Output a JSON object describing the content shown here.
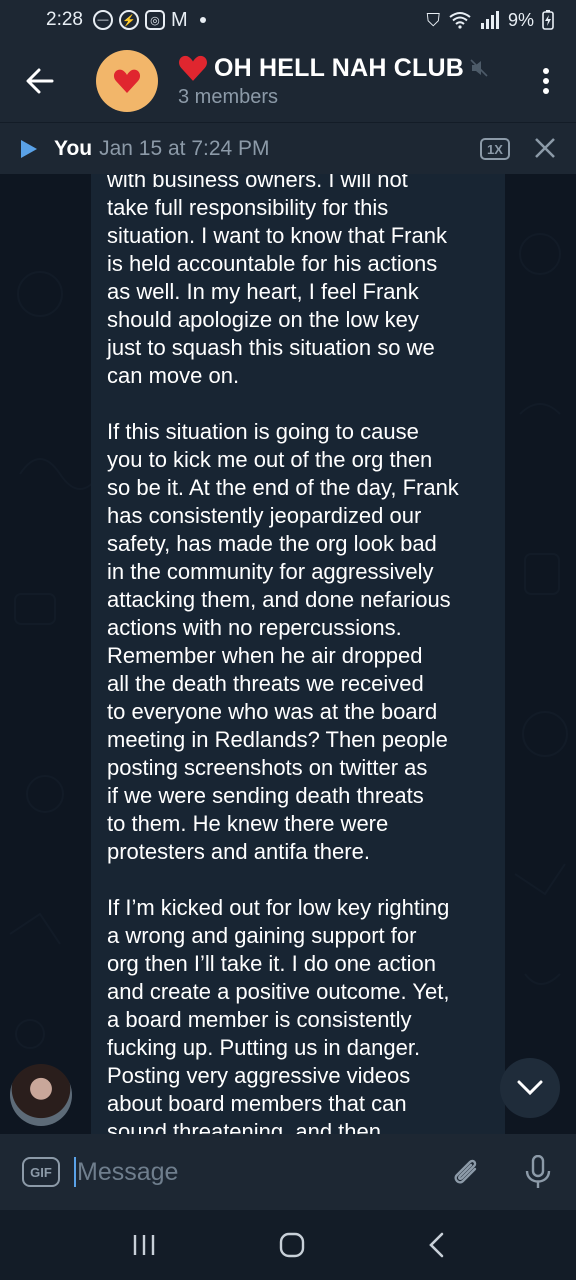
{
  "status_bar": {
    "time": "2:28",
    "battery": "9%"
  },
  "header": {
    "title": "OH HELL NAH CLUB",
    "subtitle": "3 members"
  },
  "player": {
    "from": "You",
    "date": "Jan 15 at 7:24 PM",
    "speed": "1X"
  },
  "message": {
    "text": "with business owners. I will not\ntake full responsibility for this\nsituation. I want to know that Frank\nis held accountable for his actions\nas well. In my heart, I feel Frank\nshould apologize on the low key\njust to squash this situation so we\ncan move on.\n\nIf this situation is going to cause\nyou to kick me out of the org then\nso be it. At the end of the day, Frank\nhas consistently jeopardized our\nsafety, has made the org look bad\nin the community for aggressively\nattacking them, and done nefarious\nactions with no repercussions.\nRemember when he air dropped\nall the death threats we received\nto everyone who was at the board\nmeeting in Redlands? Then people\nposting screenshots on twitter as\nif we were sending death threats\nto them. He knew there were\nprotesters and antifa there.\n\nIf I’m kicked out for low key righting\na wrong and gaining support for\norg then I’ll take it. I do one action\nand create a positive outcome. Yet,\na board member is consistently\nfucking up. Putting us in danger.\nPosting very aggressive videos\nabout board members that can\nsound threatening, and then"
  },
  "input": {
    "gif_label": "GIF",
    "placeholder": "Message"
  },
  "colors": {
    "accent": "#5aa2e8",
    "heart": "#e0262f",
    "avatar_bg": "#f2b66a"
  }
}
